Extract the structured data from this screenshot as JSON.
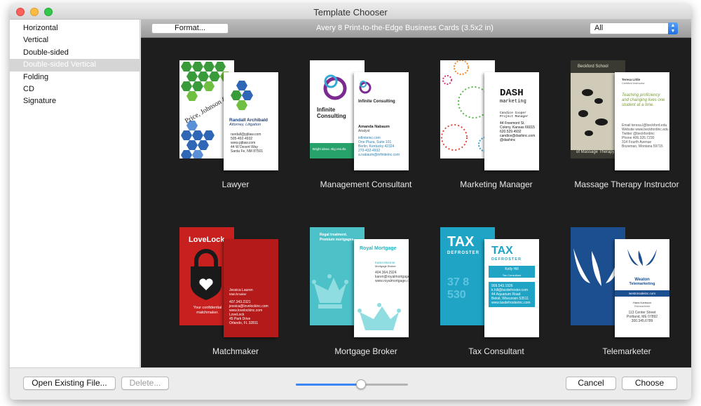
{
  "window": {
    "title": "Template Chooser"
  },
  "sidebar": {
    "items": [
      {
        "label": "Horizontal",
        "selected": false
      },
      {
        "label": "Vertical",
        "selected": false
      },
      {
        "label": "Double-sided",
        "selected": false
      },
      {
        "label": "Double-sided Vertical",
        "selected": true
      },
      {
        "label": "Folding",
        "selected": false
      },
      {
        "label": "CD",
        "selected": false
      },
      {
        "label": "Signature",
        "selected": false
      }
    ]
  },
  "toolbar": {
    "format_label": "Format...",
    "paper_title": "Avery 8 Print-to-the-Edge Business Cards (3.5x2 in)",
    "filter_value": "All"
  },
  "templates": [
    {
      "name": "Lawyer",
      "back_color": "#2f7a2e",
      "text": {
        "brand": "Price, Johnson & Turner",
        "person": "Randall Archibald",
        "role": "Attorney, Litigation",
        "lines": [
          "randall@pjtlaw.com",
          "505-492-4932",
          "www.pjtlaw.com",
          "44 W Desert Way",
          "Santa Fe, NM 87501"
        ]
      }
    },
    {
      "name": "Management Consultant",
      "back_color": "#ffffff",
      "text": {
        "brand": "Infinite Consulting",
        "person": "Amanda Nabaum",
        "role": "Analyst",
        "tagline": "Bright ideas. Big results.",
        "lines": [
          "infiniteinc.com",
          "One Plaza, Suite 101",
          "Berlin, Kentucky 42324",
          "270-432-4932",
          "a.nabaum@infiniteinc.com"
        ]
      }
    },
    {
      "name": "Marketing Manager",
      "back_color": "#ffffff",
      "text": {
        "brand": "DASH",
        "brand_sub": "marketing",
        "person": "Candice Cooper",
        "role": "Project Manager",
        "lines": [
          "44 Freemont St.",
          "Colony, Kansas 66015",
          "620.529.4932",
          "candice@dashinc.com",
          "@dashinc"
        ]
      }
    },
    {
      "name": "Massage Therapy Instructor",
      "back_color": "#3a3a32",
      "text": {
        "brand": "Beckford School",
        "brand_sub": "of Massage Therapy",
        "person": "Teresa Little",
        "role": "Certified Instructor",
        "quote": "Teaching proficiency and changing lives one student at a time.",
        "lines": [
          "Email teresa.l@beckford.edu",
          "Website www.beckfordinc.edu",
          "Twitter @beckfordinc",
          "Phone 406.326.7230",
          "314 Fourth Avenue",
          "Bozeman, Montana 59715"
        ]
      }
    },
    {
      "name": "Matchmaker",
      "back_color": "#c8201e",
      "text": {
        "brand": "LoveLock",
        "person": "Jessica Lauren",
        "role": "Matchmaker",
        "tagline": "Your confidential matchmaker.",
        "lines": [
          "407.343.2321",
          "jessica@lovelockinc.com",
          "www.lovelockinc.com",
          "LoveLock",
          "45 Park Drive",
          "Orlando, FL 32811"
        ]
      }
    },
    {
      "name": "Mortgage Broker",
      "back_color": "#4cc2c8",
      "text": {
        "brand": "Royal Mortgage",
        "person": "Karen Monroe",
        "role": "Mortgage Broker",
        "tagline": "Regal treatment. Premium mortgages.",
        "lines": [
          "404.364.2924",
          "karen@royalmortgage.com",
          "www.royalmortgage.com"
        ]
      }
    },
    {
      "name": "Tax Consultant",
      "back_color": "#1fa4c6",
      "text": {
        "brand": "TAX",
        "brand_sub": "DEFROSTER",
        "person": "Kelly Hill",
        "role": "Tax Consultant",
        "lines": [
          "909.543.1926",
          "k.hill@taxdefroster.com",
          "44 Aquarium Road",
          "Beloit, Wisconsin 53511",
          "www.taxdefrosterinc.com"
        ]
      }
    },
    {
      "name": "Telemarketer",
      "back_color": "#1b4f8f",
      "text": {
        "brand": "Weaton",
        "brand_sub": "Telemarketing",
        "url": "westonsaleinc.com",
        "person": "Hana Karlsson",
        "role": "Telemarketer",
        "lines": [
          "113 Center Street",
          "Portland, ME 07892",
          "300.345.6789"
        ]
      }
    }
  ],
  "footer": {
    "open_label": "Open Existing File...",
    "delete_label": "Delete...",
    "cancel_label": "Cancel",
    "choose_label": "Choose",
    "zoom_fraction": 0.58
  },
  "colors": {
    "accent": "#3b86f5",
    "grid_bg": "#1e1e1e"
  }
}
